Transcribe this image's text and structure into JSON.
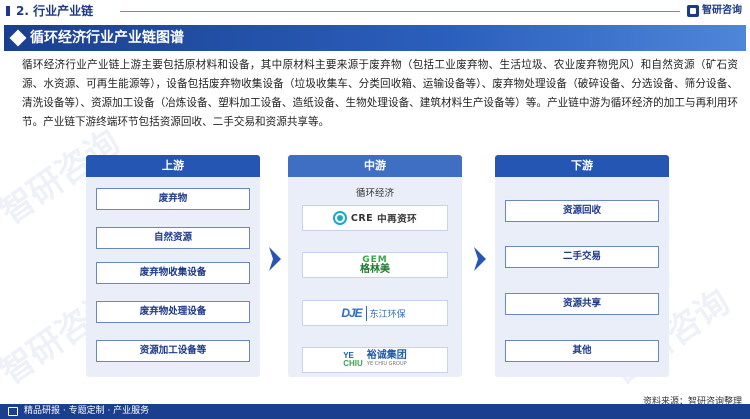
{
  "header": {
    "section": "2. 行业产业链",
    "brand": "智研咨询"
  },
  "title": "循环经济行业产业链图谱",
  "intro": "循环经济行业产业链上游主要包括原材料和设备，其中原材料主要来源于废弃物（包括工业废弃物、生活垃圾、农业废弃物兜风）和自然资源（矿石资源、水资源、可再生能源等），设备包括废弃物收集设备（垃圾收集车、分类回收箱、运输设备等）、废弃物处理设备（破碎设备、分选设备、筛分设备、清洗设备等）、资源加工设备（冶炼设备、塑料加工设备、造纸设备、生物处理设备、建筑材料生产设备等）等。产业链中游为循环经济的加工与再利用环节。产业链下游终端环节包括资源回收、二手交易和资源共享等。",
  "upstream": {
    "header": "上游",
    "items": [
      "废弃物",
      "自然资源",
      "废弃物收集设备",
      "废弃物处理设备",
      "资源加工设备等"
    ]
  },
  "midstream": {
    "header": "中游",
    "label": "循环经济",
    "logos": {
      "cre": {
        "mark": "CRE",
        "text": "中再资环"
      },
      "gem": {
        "en": "GEM",
        "cn": "格林美"
      },
      "dje": {
        "mark": "DJE",
        "text": "东江环保"
      },
      "yc": {
        "mark_top": "YE",
        "mark_bottom": "CHIU",
        "cn": "裕诚集团",
        "en": "YE CHIU GROUP"
      }
    }
  },
  "downstream": {
    "header": "下游",
    "items": [
      "资源回收",
      "二手交易",
      "资源共享",
      "其他"
    ]
  },
  "footer": {
    "source": "资料来源：智研咨询整理",
    "tagline": "精品研报 · 专题定制 · 产业服务"
  },
  "watermark": "智研咨询",
  "colors": {
    "primary": "#1b3f8f",
    "accent": "#2556b3",
    "panel_bg": "#e9eef8"
  }
}
